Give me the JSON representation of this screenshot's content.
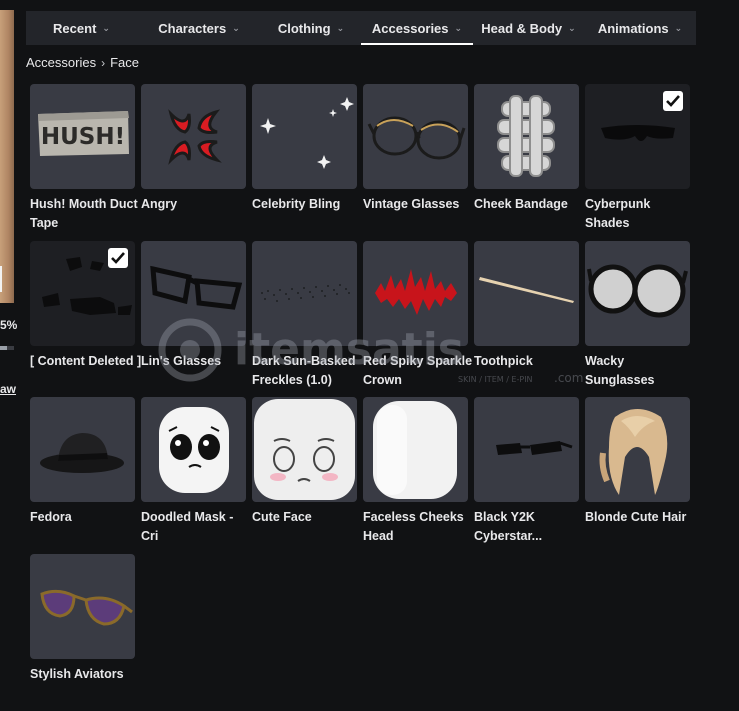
{
  "avatar_panel": {
    "percent_text": "5%",
    "percent_value": 0.5,
    "link_text": "aw"
  },
  "tabs": [
    {
      "label": "Recent",
      "active": false
    },
    {
      "label": "Characters",
      "active": false
    },
    {
      "label": "Clothing",
      "active": false
    },
    {
      "label": "Accessories",
      "active": true
    },
    {
      "label": "Head & Body",
      "active": false
    },
    {
      "label": "Animations",
      "active": false
    }
  ],
  "breadcrumb": {
    "parent": "Accessories",
    "current": "Face"
  },
  "items": [
    {
      "name": "Hush! Mouth Duct Tape",
      "icon": "duct-tape",
      "selected": false
    },
    {
      "name": "Angry",
      "icon": "angry-vein",
      "selected": false
    },
    {
      "name": "Celebrity Bling",
      "icon": "sparkles",
      "selected": false
    },
    {
      "name": "Vintage Glasses",
      "icon": "round-glasses",
      "selected": false
    },
    {
      "name": "Cheek Bandage",
      "icon": "bandage",
      "selected": false
    },
    {
      "name": "Cyberpunk Shades",
      "icon": "visor-shades",
      "selected": true
    },
    {
      "name": "[ Content Deleted ]",
      "icon": "deleted-item",
      "selected": true
    },
    {
      "name": "Lin's Glasses",
      "icon": "rect-glasses",
      "selected": false
    },
    {
      "name": "Dark Sun-Basked Freckles (1.0)",
      "icon": "freckles",
      "selected": false
    },
    {
      "name": "Red Spiky Sparkle Crown",
      "icon": "spiky-crown",
      "selected": false
    },
    {
      "name": "Toothpick",
      "icon": "toothpick",
      "selected": false
    },
    {
      "name": "Wacky Sunglasses",
      "icon": "big-glasses",
      "selected": false
    },
    {
      "name": "Fedora",
      "icon": "fedora",
      "selected": false
    },
    {
      "name": "Doodled Mask - Cri",
      "icon": "doodle-mask",
      "selected": false
    },
    {
      "name": "Cute Face",
      "icon": "cute-face",
      "selected": false
    },
    {
      "name": "Faceless Cheeks Head",
      "icon": "blank-head",
      "selected": false
    },
    {
      "name": "Black Y2K Cyberstar...",
      "icon": "y2k-shades",
      "selected": false
    },
    {
      "name": "Blonde Cute Hair",
      "icon": "blonde-hair",
      "selected": false
    },
    {
      "name": "Stylish Aviators",
      "icon": "aviators",
      "selected": false
    }
  ],
  "watermark": {
    "brand": "itemsatis",
    "tagline": "SKIN / ITEM / E-PIN",
    "domain": ".com"
  },
  "colors": {
    "background": "#111214",
    "tabbar": "#23252a",
    "tile": "#393b44",
    "text": "#e8e8ea"
  }
}
